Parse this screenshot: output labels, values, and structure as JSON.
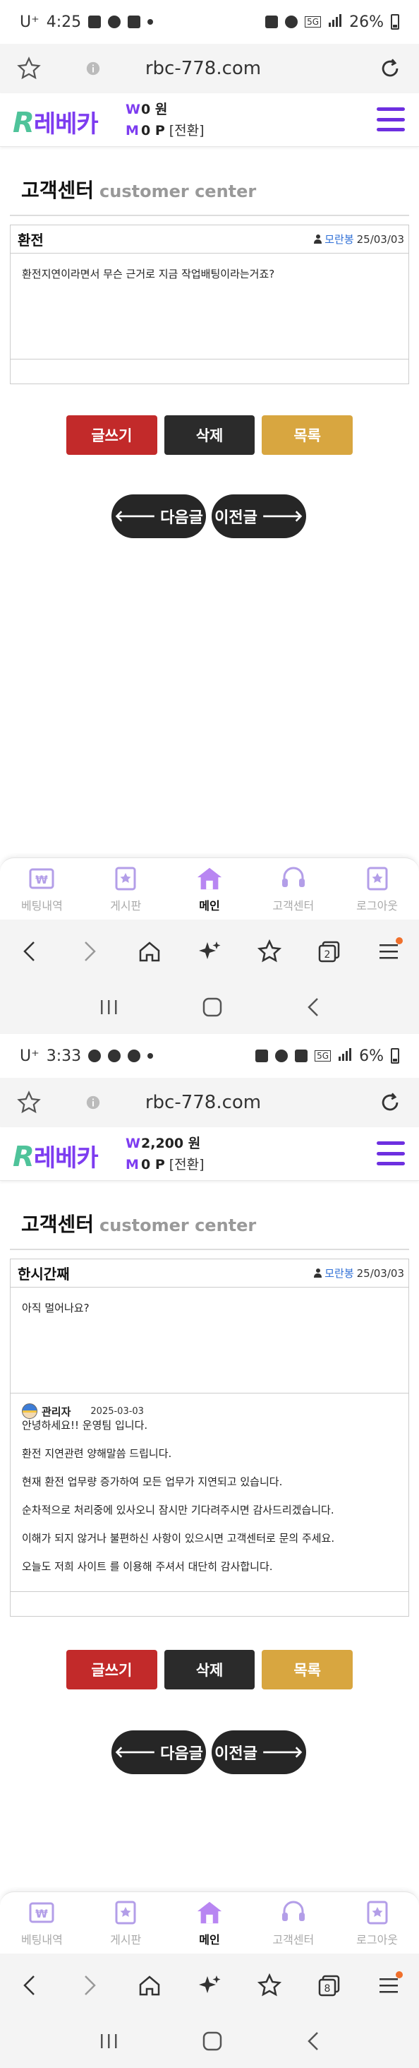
{
  "browser": {
    "url": "rbc-778.com"
  },
  "site": {
    "logo_r": "R",
    "logo_text": "레베카",
    "won_label": "W",
    "point_label": "M",
    "convert_label": "[전환]",
    "page_title": "고객센터",
    "page_subtitle": "customer center"
  },
  "buttons": {
    "write": "글쓰기",
    "delete": "삭제",
    "list": "목록",
    "next": "다음글",
    "prev": "이전글",
    "next_arrow": "🡐",
    "prev_arrow": "🡒"
  },
  "bottom_nav": {
    "items": [
      "베팅내역",
      "게시판",
      "메인",
      "고객센터",
      "로그아웃"
    ],
    "active_index": 2
  },
  "colors": {
    "brand_purple": "#7d3cf0",
    "logo_green": "#4fc39a",
    "write_red": "#c22a2a",
    "delete_dark": "#2b2b2b",
    "list_gold": "#d8a640",
    "author_blue": "#2f6fd6"
  },
  "screens": [
    {
      "status": {
        "carrier": "U⁺",
        "time": "4:25",
        "battery": "26%",
        "network": "5G"
      },
      "balance": {
        "won": "0 원",
        "point": "0 P"
      },
      "post": {
        "subject": "환전",
        "author": "모란봉",
        "date": "25/03/03",
        "body": "환전지연이라면서 무슨 근거로 지금 작업배팅이라는거죠?"
      },
      "browser_tabs": "2"
    },
    {
      "status": {
        "carrier": "U⁺",
        "time": "3:33",
        "battery": "6%",
        "network": "5G"
      },
      "balance": {
        "won": "2,200 원",
        "point": "0 P"
      },
      "post": {
        "subject": "한시간째",
        "author": "모란봉",
        "date": "25/03/03",
        "body": "아직 멀어나요?"
      },
      "reply": {
        "author": "관리자",
        "date": "2025-03-03",
        "lines": [
          "안녕하세요!! 운영팀 입니다.",
          "환전 지연관련 양해말씀 드립니다.",
          "현재 환전 업무량 증가하여 모든 업무가 지연되고 있습니다.",
          "순차적으로 처리중에 있사오니 잠시만 기다려주시면 감사드리겠습니다.",
          "이해가 되지 않거나 불편하신 사항이 있으시면 고객센터로 문의 주세요.",
          "오늘도 저희 사이트 를 이용해 주셔서 대단히 감사합니다."
        ]
      },
      "browser_tabs": "8"
    }
  ]
}
